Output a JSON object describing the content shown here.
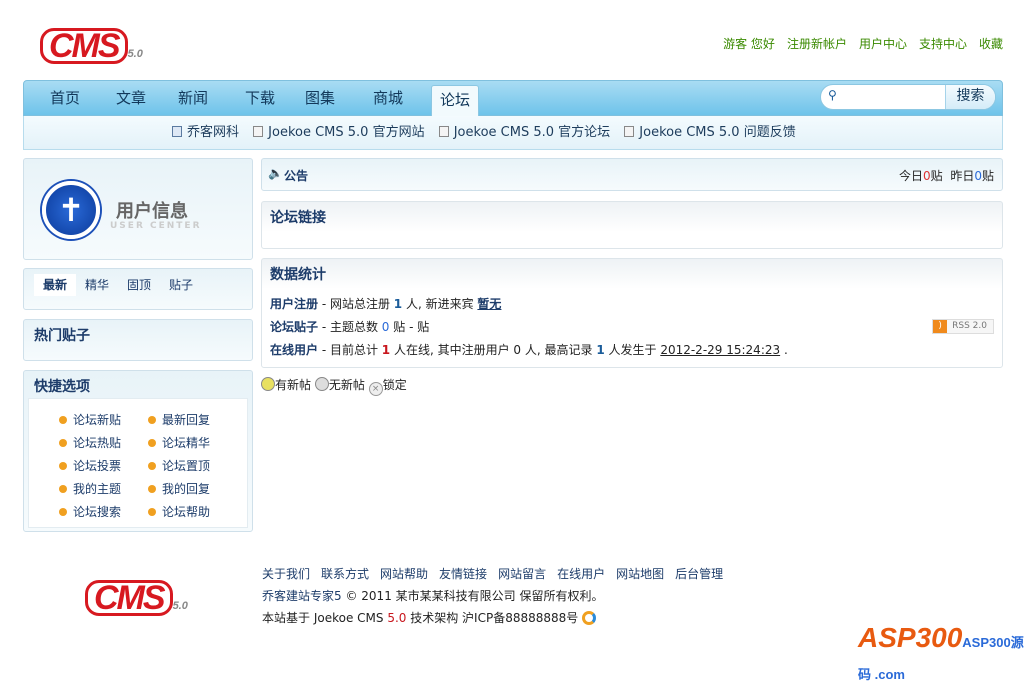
{
  "header": {
    "logo_text": "CMS",
    "logo_version": "5.0",
    "links": [
      "游客 您好",
      "注册新帐户",
      "用户中心",
      "支持中心",
      "收藏"
    ]
  },
  "nav": {
    "items": [
      "首页",
      "文章",
      "新闻",
      "下载",
      "图集",
      "商城",
      "论坛"
    ],
    "active": "论坛",
    "search_placeholder": "",
    "search_button": "搜索"
  },
  "subnav": [
    "乔客网科",
    "Joekoe CMS 5.0 官方网站",
    "Joekoe CMS 5.0 官方论坛",
    "Joekoe CMS 5.0 问题反馈"
  ],
  "sidebar": {
    "user_title": "用户信息",
    "user_sub": "USER CENTER",
    "tabs": [
      "最新",
      "精华",
      "固顶",
      "贴子"
    ],
    "hot_title": "热门贴子",
    "quick_title": "快捷选项",
    "quick_links": [
      "论坛新贴",
      "最新回复",
      "论坛热贴",
      "论坛精华",
      "论坛投票",
      "论坛置顶",
      "我的主题",
      "我的回复",
      "论坛搜索",
      "论坛帮助"
    ]
  },
  "notice": {
    "title": "公告",
    "today_label": "今日",
    "today": "0",
    "yesterday_label": "昨日",
    "yesterday": "0",
    "unit": "贴"
  },
  "links_box": {
    "title": "论坛链接"
  },
  "stats": {
    "title": "数据统计",
    "reg_label": "用户注册",
    "reg_text1": " - 网站总注册 ",
    "reg_count": "1",
    "reg_text2": " 人, 新进来宾 ",
    "reg_newest": "暂无",
    "post_label": "论坛贴子",
    "post_text1": " - 主题总数 ",
    "post_count": "0",
    "post_text2": " 贴 - 贴",
    "online_label": "在线用户",
    "online_text1": " - 目前总计 ",
    "online_count": "1",
    "online_text2": " 人在线, 其中注册用户 0 人, 最高记录 ",
    "online_max": "1",
    "online_text3": " 人发生于 ",
    "online_date": "2012-2-29 15:24:23",
    "online_end": " .",
    "rss": "RSS 2.0"
  },
  "legend": [
    "有新帖",
    "无新帖",
    "锁定"
  ],
  "footer": {
    "links": [
      "关于我们",
      "联系方式",
      "网站帮助",
      "友情链接",
      "网站留言",
      "在线用户",
      "网站地图",
      "后台管理"
    ],
    "line2_brand": "乔客建站专家5",
    "line2_text": "© 2011 某市某某科技有限公司 保留所有权利。",
    "line3_a": "本站基于 Joekoe CMS ",
    "line3_ver": "5.0",
    "line3_b": " 技术架构  沪ICP备88888888号",
    "watermark": "ASP300源码 .com"
  }
}
